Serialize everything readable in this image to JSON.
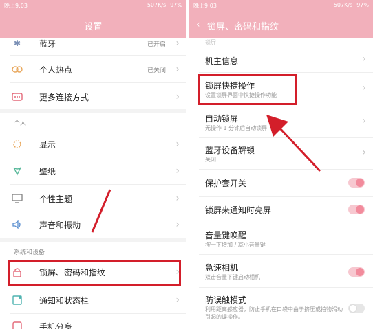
{
  "left": {
    "status": {
      "time": "晚上9:03",
      "net": "507K/s",
      "battery": "97%"
    },
    "title": "设置",
    "rows_top": [
      {
        "label": "蓝牙",
        "status": "已开启"
      },
      {
        "label": "个人热点",
        "status": "已关闭"
      },
      {
        "label": "更多连接方式",
        "status": ""
      }
    ],
    "section_personal": "个人",
    "rows_personal": [
      {
        "label": "显示"
      },
      {
        "label": "壁纸"
      },
      {
        "label": "个性主题"
      },
      {
        "label": "声音和振动"
      }
    ],
    "section_system": "系统和设备",
    "rows_system": [
      {
        "label": "锁屏、密码和指纹"
      },
      {
        "label": "通知和状态栏"
      },
      {
        "label": "手机分身"
      }
    ]
  },
  "right": {
    "status": {
      "time": "晚上9:03",
      "net": "507K/s",
      "battery": "97%"
    },
    "title": "锁屏、密码和指纹",
    "partial_label": "锁屏",
    "rows": [
      {
        "label": "机主信息",
        "sub": "",
        "control": "chevron"
      },
      {
        "label": "锁屏快捷操作",
        "sub": "设置锁屏界面中快捷操作功能",
        "control": "chevron"
      },
      {
        "label": "自动锁屏",
        "sub": "无操作 1 分钟后自动锁屏",
        "control": "chevron"
      },
      {
        "label": "蓝牙设备解锁",
        "sub": "关闭",
        "control": "chevron"
      },
      {
        "label": "保护套开关",
        "sub": "",
        "control": "toggle-on"
      },
      {
        "label": "锁屏来通知时亮屏",
        "sub": "",
        "control": "toggle-on"
      },
      {
        "label": "音量键唤醒",
        "sub": "按一下增加 / 减小音量键",
        "control": "none"
      },
      {
        "label": "急速相机",
        "sub": "双击音量下键启动相机",
        "control": "toggle-on"
      },
      {
        "label": "防误触模式",
        "sub": "利用距离感应器，防止手机在口袋中由于挤压或拍物滑动引起的误操作。",
        "control": "toggle-off"
      }
    ]
  },
  "colors": {
    "header": "#f2b0bb",
    "highlight": "#d31e2a",
    "toggle_on": "#f28b9c"
  }
}
